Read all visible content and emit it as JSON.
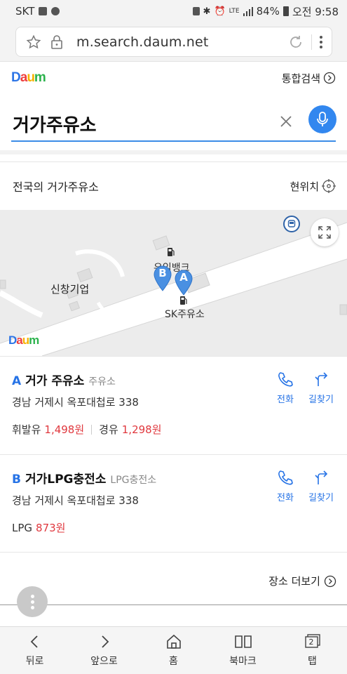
{
  "status_bar": {
    "carrier": "SKT",
    "network": "LTE",
    "battery": "84%",
    "time": "오전 9:58"
  },
  "browser": {
    "url": "m.search.daum.net"
  },
  "header": {
    "logo_letters": [
      "D",
      "a",
      "u",
      "m"
    ],
    "unified_search": "통합검색"
  },
  "search": {
    "query": "거가주유소"
  },
  "section": {
    "title": "전국의 거가주유소",
    "current_location": "현위치"
  },
  "map": {
    "labels": {
      "bank": "우임뱅크",
      "company": "신창기업",
      "station": "SK주유소"
    },
    "marker_a": "A",
    "marker_b": "B",
    "colors": {
      "marker": "#4a90e2",
      "road": "#ffffff",
      "ground": "#ececec"
    }
  },
  "results": [
    {
      "letter": "A",
      "name": "거가 주유소",
      "category": "주유소",
      "address": "경남 거제시 옥포대첩로 338",
      "prices": [
        {
          "label": "휘발유",
          "value": "1,498원"
        },
        {
          "label": "경유",
          "value": "1,298원"
        }
      ],
      "call": "전화",
      "directions": "길찾기"
    },
    {
      "letter": "B",
      "name": "거가LPG충전소",
      "category": "LPG충전소",
      "address": "경남 거제시 옥포대첩로 338",
      "prices": [
        {
          "label": "LPG",
          "value": "873원"
        }
      ],
      "call": "전화",
      "directions": "길찾기"
    }
  ],
  "more_places": "장소 더보기",
  "bottom_nav": {
    "back": "뒤로",
    "forward": "앞으로",
    "home": "홈",
    "bookmark": "북마크",
    "tabs": "탭",
    "tab_count": "2"
  },
  "colors": {
    "accent": "#2673e6",
    "price": "#e0383e"
  }
}
